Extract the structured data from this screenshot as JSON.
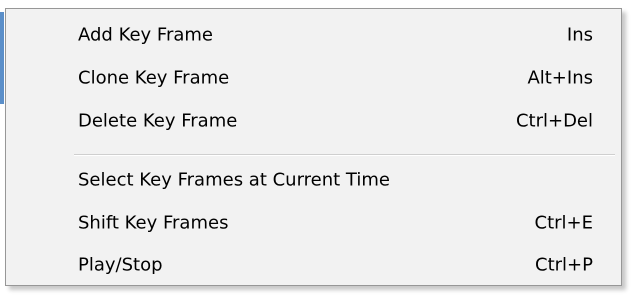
{
  "menu": {
    "items": [
      {
        "label": "Add Key Frame",
        "shortcut": "Ins"
      },
      {
        "label": "Clone Key Frame",
        "shortcut": "Alt+Ins"
      },
      {
        "label": "Delete Key Frame",
        "shortcut": "Ctrl+Del"
      },
      {
        "label": "Select Key Frames at Current Time",
        "shortcut": ""
      },
      {
        "label": "Shift Key Frames",
        "shortcut": "Ctrl+E"
      },
      {
        "label": "Play/Stop",
        "shortcut": "Ctrl+P"
      }
    ]
  },
  "colors": {
    "menu_background": "#f2f2f2",
    "menu_border": "#979797",
    "separator": "#cfcfcf",
    "text": "#000000"
  }
}
